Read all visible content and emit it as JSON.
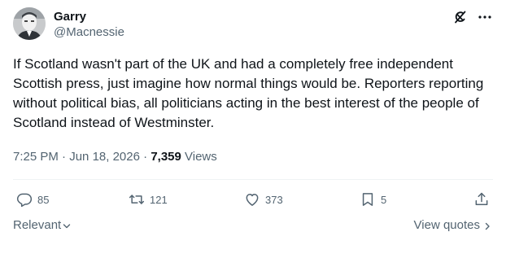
{
  "author": {
    "name": "Garry",
    "handle": "@Macnessie"
  },
  "tweet": {
    "text": "If Scotland wasn't part of the UK and had a completely free independent Scottish press, just imagine how normal things would be. Reporters reporting without political bias, all politicians acting in the best interest of the people of Scotland instead of Westminster."
  },
  "meta": {
    "time": "7:25 PM",
    "separator1": " · ",
    "date": "Jun 18, 2026",
    "separator2": " · ",
    "views_count": "7,359",
    "views_label": " Views"
  },
  "actions": {
    "replies": "85",
    "retweets": "121",
    "likes": "373",
    "bookmarks": "5"
  },
  "footer": {
    "sort_label": "Relevant",
    "view_quotes_label": "View quotes"
  },
  "icons": {
    "avatar": "avatar",
    "grok": "grok-icon",
    "more": "more-icon",
    "reply": "reply-icon",
    "retweet": "retweet-icon",
    "like": "heart-icon",
    "bookmark": "bookmark-icon",
    "share": "share-icon"
  },
  "colors": {
    "text": "#0f1419",
    "secondary": "#536471",
    "divider": "#eff3f4"
  }
}
